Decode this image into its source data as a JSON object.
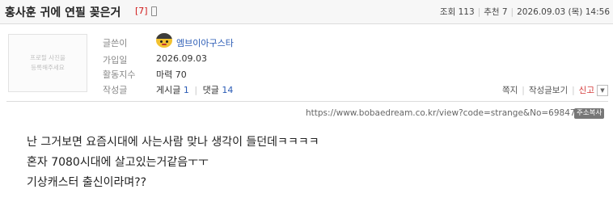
{
  "post": {
    "title": "홍사훈 귀에 연필 꽂은거",
    "comment_count": "[7]",
    "views_label": "조회",
    "views": "113",
    "recommend_label": "추천",
    "recommend": "7",
    "datetime": "2026.09.03 (목) 14:56"
  },
  "author": {
    "photo_placeholder": "프로필 사진을\n등록해주세요",
    "writer_label": "글쓴이",
    "nickname": "엠브이아구스타",
    "joined_label": "가입일",
    "joined": "2026.09.03",
    "activity_label": "활동지수",
    "activity": "마력 70",
    "written_label": "작성글",
    "posts_label": "게시글",
    "posts_count": "1",
    "comments_label": "댓글",
    "comments_count": "14"
  },
  "actions": {
    "message": "쪽지",
    "view_posts": "작성글보기",
    "report": "신고"
  },
  "link": {
    "url": "https://www.bobaedream.co.kr/view?code=strange&No=6984716",
    "copy_label": "주소복사"
  },
  "content": {
    "lines": [
      "난 그거보면 요즘시대에 사는사람 맞나 생각이 들던데ㅋㅋㅋㅋ",
      "혼자 7080시대에 살고있는거같음ㅜㅜ",
      "기상캐스터 출신이라며??"
    ]
  },
  "colors": {
    "accent_blue": "#2a5bb5",
    "report_red": "#d43838",
    "comment_count_red": "#d01818"
  }
}
